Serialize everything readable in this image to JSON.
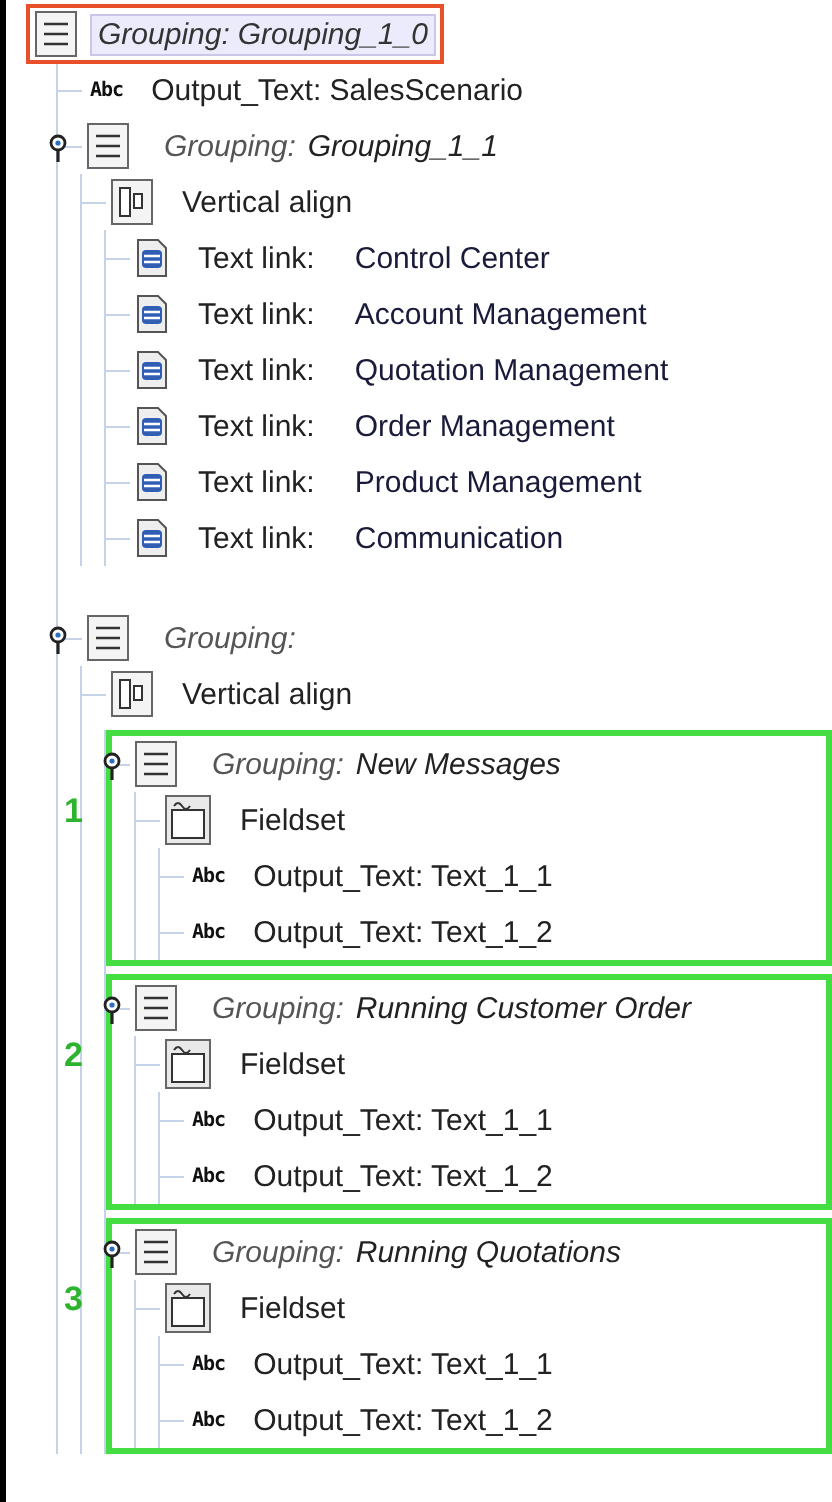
{
  "tree": [
    {
      "kind": "grouping",
      "label": "Grouping:",
      "name": "Grouping_1_0",
      "selected": true,
      "pinned": false,
      "children": [
        {
          "kind": "output",
          "badge": "Abc",
          "label": "Output_Text: SalesScenario",
          "selected": false
        },
        {
          "kind": "grouping",
          "label": "Grouping:",
          "name": "Grouping_1_1",
          "selected": false,
          "pinned": true,
          "children": [
            {
              "kind": "valign",
              "label": "Vertical align",
              "selected": false,
              "children": [
                {
                  "kind": "link",
                  "label": "Text link:",
                  "target": "Control Center",
                  "selected": false
                },
                {
                  "kind": "link",
                  "label": "Text link:",
                  "target": "Account Management",
                  "selected": false
                },
                {
                  "kind": "link",
                  "label": "Text link:",
                  "target": "Quotation Management",
                  "selected": false
                },
                {
                  "kind": "link",
                  "label": "Text link:",
                  "target": "Order Management",
                  "selected": false
                },
                {
                  "kind": "link",
                  "label": "Text link:",
                  "target": "Product Management",
                  "selected": false
                },
                {
                  "kind": "link",
                  "label": "Text link:",
                  "target": "Communication",
                  "selected": false
                }
              ]
            }
          ]
        },
        {
          "kind": "grouping",
          "label": "Grouping:",
          "selected": false,
          "pinned": true,
          "children": [
            {
              "kind": "valign",
              "label": "Vertical align",
              "selected": false,
              "children": [
                {
                  "kind": "grouping",
                  "label": "Grouping:",
                  "name": "New Messages",
                  "selected": false,
                  "pinned": true,
                  "callout": "1",
                  "children": [
                    {
                      "kind": "fieldset",
                      "label": "Fieldset",
                      "selected": false,
                      "children": [
                        {
                          "kind": "output",
                          "badge": "Abc",
                          "label": "Output_Text: Text_1_1",
                          "selected": false
                        },
                        {
                          "kind": "output",
                          "badge": "Abc",
                          "label": "Output_Text: Text_1_2",
                          "selected": false
                        }
                      ]
                    }
                  ]
                },
                {
                  "kind": "grouping",
                  "label": "Grouping:",
                  "name": "Running Customer Order",
                  "selected": false,
                  "pinned": true,
                  "callout": "2",
                  "children": [
                    {
                      "kind": "fieldset",
                      "label": "Fieldset",
                      "selected": false,
                      "children": [
                        {
                          "kind": "output",
                          "badge": "Abc",
                          "label": "Output_Text: Text_1_1",
                          "selected": false
                        },
                        {
                          "kind": "output",
                          "badge": "Abc",
                          "label": "Output_Text: Text_1_2",
                          "selected": false
                        }
                      ]
                    }
                  ]
                },
                {
                  "kind": "grouping",
                  "label": "Grouping:",
                  "name": "Running Quotations",
                  "selected": false,
                  "pinned": true,
                  "callout": "3",
                  "children": [
                    {
                      "kind": "fieldset",
                      "label": "Fieldset",
                      "selected": false,
                      "children": [
                        {
                          "kind": "output",
                          "badge": "Abc",
                          "label": "Output_Text: Text_1_1",
                          "selected": false
                        },
                        {
                          "kind": "output",
                          "badge": "Abc",
                          "label": "Output_Text: Text_1_2",
                          "selected": false
                        }
                      ]
                    }
                  ]
                }
              ]
            }
          ]
        }
      ]
    }
  ]
}
